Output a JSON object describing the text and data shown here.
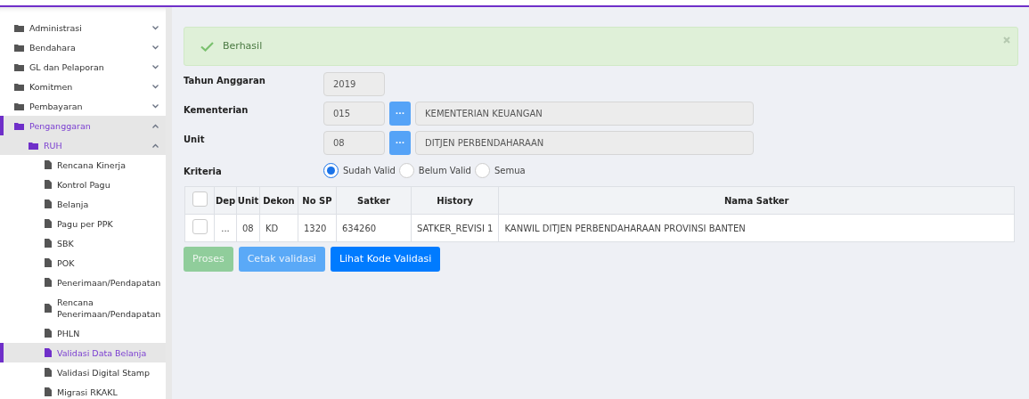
{
  "sidebar": {
    "items": [
      {
        "label": "Administrasi",
        "kind": "folder",
        "expanded": false
      },
      {
        "label": "Bendahara",
        "kind": "folder",
        "expanded": false
      },
      {
        "label": "GL dan Pelaporan",
        "kind": "folder",
        "expanded": false
      },
      {
        "label": "Komitmen",
        "kind": "folder",
        "expanded": false
      },
      {
        "label": "Pembayaran",
        "kind": "folder",
        "expanded": false
      },
      {
        "label": "Penganggaran",
        "kind": "folder",
        "expanded": true,
        "children": [
          {
            "label": "RUH",
            "kind": "folder",
            "expanded": true,
            "children": [
              {
                "label": "Rencana Kinerja",
                "kind": "page",
                "selected": false
              },
              {
                "label": "Kontrol Pagu",
                "kind": "page",
                "selected": false
              },
              {
                "label": "Belanja",
                "kind": "page",
                "selected": false
              },
              {
                "label": "Pagu per PPK",
                "kind": "page",
                "selected": false
              },
              {
                "label": "SBK",
                "kind": "page",
                "selected": false
              },
              {
                "label": "POK",
                "kind": "page",
                "selected": false
              },
              {
                "label": "Penerimaan/Pendapatan",
                "kind": "page",
                "selected": false
              },
              {
                "label": "Rencana Penerimaan/Pendapatan",
                "kind": "page",
                "selected": false
              },
              {
                "label": "PHLN",
                "kind": "page",
                "selected": false
              },
              {
                "label": "Validasi Data Belanja",
                "kind": "page",
                "selected": true
              },
              {
                "label": "Validasi Digital Stamp",
                "kind": "page",
                "selected": false
              },
              {
                "label": "Migrasi RKAKL",
                "kind": "page",
                "selected": false
              }
            ]
          }
        ]
      }
    ]
  },
  "alert": {
    "message": "Berhasil"
  },
  "form": {
    "tahun_anggaran": {
      "label": "Tahun Anggaran",
      "value": "2019"
    },
    "kementerian": {
      "label": "Kementerian",
      "code": "015",
      "button": "···",
      "name": "KEMENTERIAN KEUANGAN"
    },
    "unit": {
      "label": "Unit",
      "code": "08",
      "button": "···",
      "name": "DITJEN PERBENDAHARAAN"
    },
    "kriteria": {
      "label": "Kriteria",
      "options": [
        {
          "label": "Sudah Valid",
          "selected": true
        },
        {
          "label": "Belum Valid",
          "selected": false
        },
        {
          "label": "Semua",
          "selected": false
        }
      ]
    }
  },
  "table": {
    "header_checked": false,
    "columns": [
      "Dep",
      "Unit",
      "Dekon",
      "No SP",
      "Satker",
      "History",
      "Nama Satker"
    ],
    "rows": [
      {
        "checked": false,
        "cells": [
          "...",
          "08",
          "KD",
          "1320",
          "634260",
          "SATKER_REVISI 1",
          "KANWIL DITJEN PERBENDAHARAAN PROVINSI BANTEN"
        ]
      }
    ]
  },
  "buttons": [
    {
      "label": "Proses",
      "kind": "success",
      "disabled": true
    },
    {
      "label": "Cetak validasi",
      "kind": "info",
      "disabled": true
    },
    {
      "label": "Lihat Kode Validasi",
      "kind": "primary",
      "disabled": false
    }
  ]
}
